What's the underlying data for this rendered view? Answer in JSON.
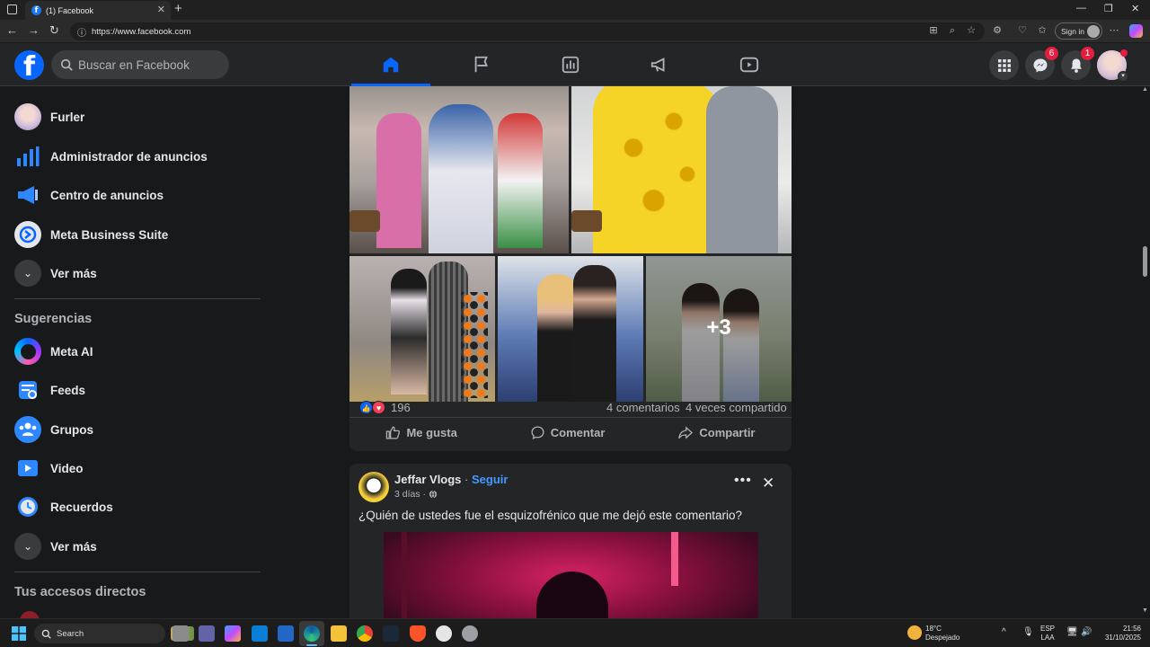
{
  "browser": {
    "tab_title": "(1) Facebook",
    "url": "https://www.facebook.com",
    "sign_in_label": "Sign in"
  },
  "fb": {
    "search_placeholder": "Buscar en Facebook",
    "messenger_count": "6",
    "notifications_count": "1",
    "nav": [
      "home-icon",
      "pages-flag-icon",
      "stats-icon",
      "ads-megaphone-icon",
      "video-icon"
    ],
    "colors": {
      "accent": "#0866ff",
      "badge": "#e41e3f",
      "surface": "#242526",
      "background": "#18191a"
    }
  },
  "sidebar": {
    "items": [
      {
        "label": "Furler",
        "icon": "avatar"
      },
      {
        "label": "Administrador de anuncios",
        "icon": "bar-chart-icon"
      },
      {
        "label": "Centro de anuncios",
        "icon": "megaphone-icon"
      },
      {
        "label": "Meta Business Suite",
        "icon": "meta-business-icon"
      },
      {
        "label": "Ver más",
        "icon": "chevron-down-icon"
      }
    ],
    "suggestions_title": "Sugerencias",
    "suggestions": [
      {
        "label": "Meta AI",
        "icon": "meta-ai-icon"
      },
      {
        "label": "Feeds",
        "icon": "feeds-icon"
      },
      {
        "label": "Grupos",
        "icon": "groups-icon"
      },
      {
        "label": "Video",
        "icon": "video-icon"
      },
      {
        "label": "Recuerdos",
        "icon": "memories-icon"
      },
      {
        "label": "Ver más",
        "icon": "chevron-down-icon"
      }
    ],
    "shortcuts_title": "Tus accesos directos"
  },
  "post1": {
    "more_photos": "+3",
    "reactions_count": "196",
    "comments": "4 comentarios",
    "shares": "4 veces compartido",
    "like_label": "Me gusta",
    "comment_label": "Comentar",
    "share_label": "Compartir"
  },
  "post2": {
    "author": "Jeffar Vlogs",
    "separator": "·",
    "follow_label": "Seguir",
    "time": "3 días ·",
    "text": "¿Quién de ustedes fue el esquizofrénico que me dejó este comentario?"
  },
  "taskbar": {
    "search_placeholder": "Search",
    "weather_temp": "18°C",
    "weather_desc": "Despejado",
    "lang1": "ESP",
    "lang2": "LAA",
    "time": "21:56",
    "date": "31/10/2025"
  }
}
